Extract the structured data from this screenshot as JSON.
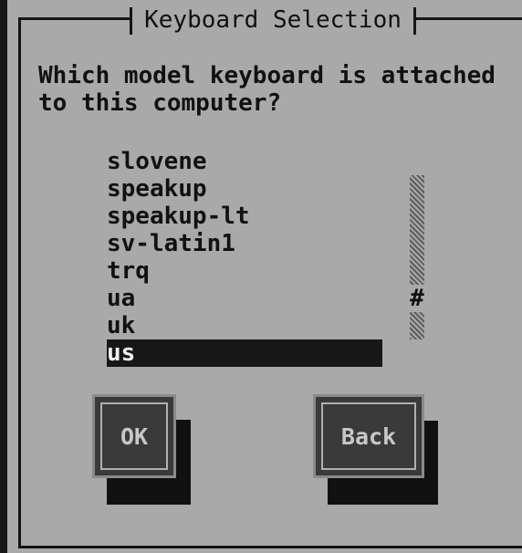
{
  "dialog": {
    "title": "Keyboard Selection",
    "prompt": "Which model keyboard is attached\nto this computer?"
  },
  "keyboard_list": {
    "items": [
      "slovene",
      "speakup",
      "speakup-lt",
      "sv-latin1",
      "trq",
      "ua",
      "uk",
      "us"
    ],
    "selected": "us"
  },
  "scrollbar": {
    "thumb_glyph": "#",
    "position_fraction": 0.8
  },
  "buttons": {
    "ok_label": "OK",
    "back_label": "Back"
  }
}
